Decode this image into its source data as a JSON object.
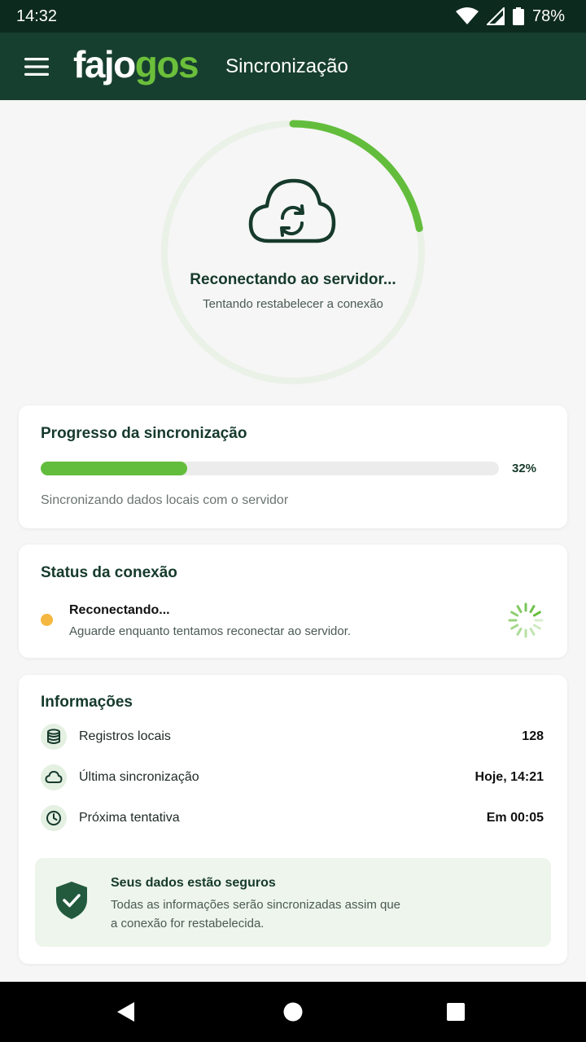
{
  "status_bar": {
    "time": "14:32",
    "battery": "78%"
  },
  "app_bar": {
    "logo_part1": "fajo",
    "logo_part2": "gos",
    "title": "Sincronização"
  },
  "hero": {
    "title": "Reconectando ao servidor...",
    "subtitle": "Tentando restabelecer a conexão",
    "ring_progress": 0.22,
    "colors": {
      "accent": "#63bd3c",
      "track": "#eaf1e7",
      "dark": "#163a2c"
    }
  },
  "progress": {
    "title": "Progresso da sincronização",
    "percent": 32,
    "percent_label": "32%",
    "description": "Sincronizando dados locais com o servidor"
  },
  "connection": {
    "title": "Status da conexão",
    "state": "Reconectando...",
    "description": "Aguarde enquanto tentamos reconectar ao servidor.",
    "status_color": "#f4b740"
  },
  "info": {
    "title": "Informações",
    "rows": [
      {
        "icon": "database-icon",
        "label": "Registros locais",
        "value": "128"
      },
      {
        "icon": "cloud-icon",
        "label": "Última sincronização",
        "value": "Hoje, 14:21"
      },
      {
        "icon": "clock-icon",
        "label": "Próxima tentativa",
        "value": "Em 00:05"
      }
    ],
    "secure": {
      "title": "Seus dados estão seguros",
      "text": "Todas as informações serão sincronizadas assim que a conexão for restabelecida."
    }
  }
}
